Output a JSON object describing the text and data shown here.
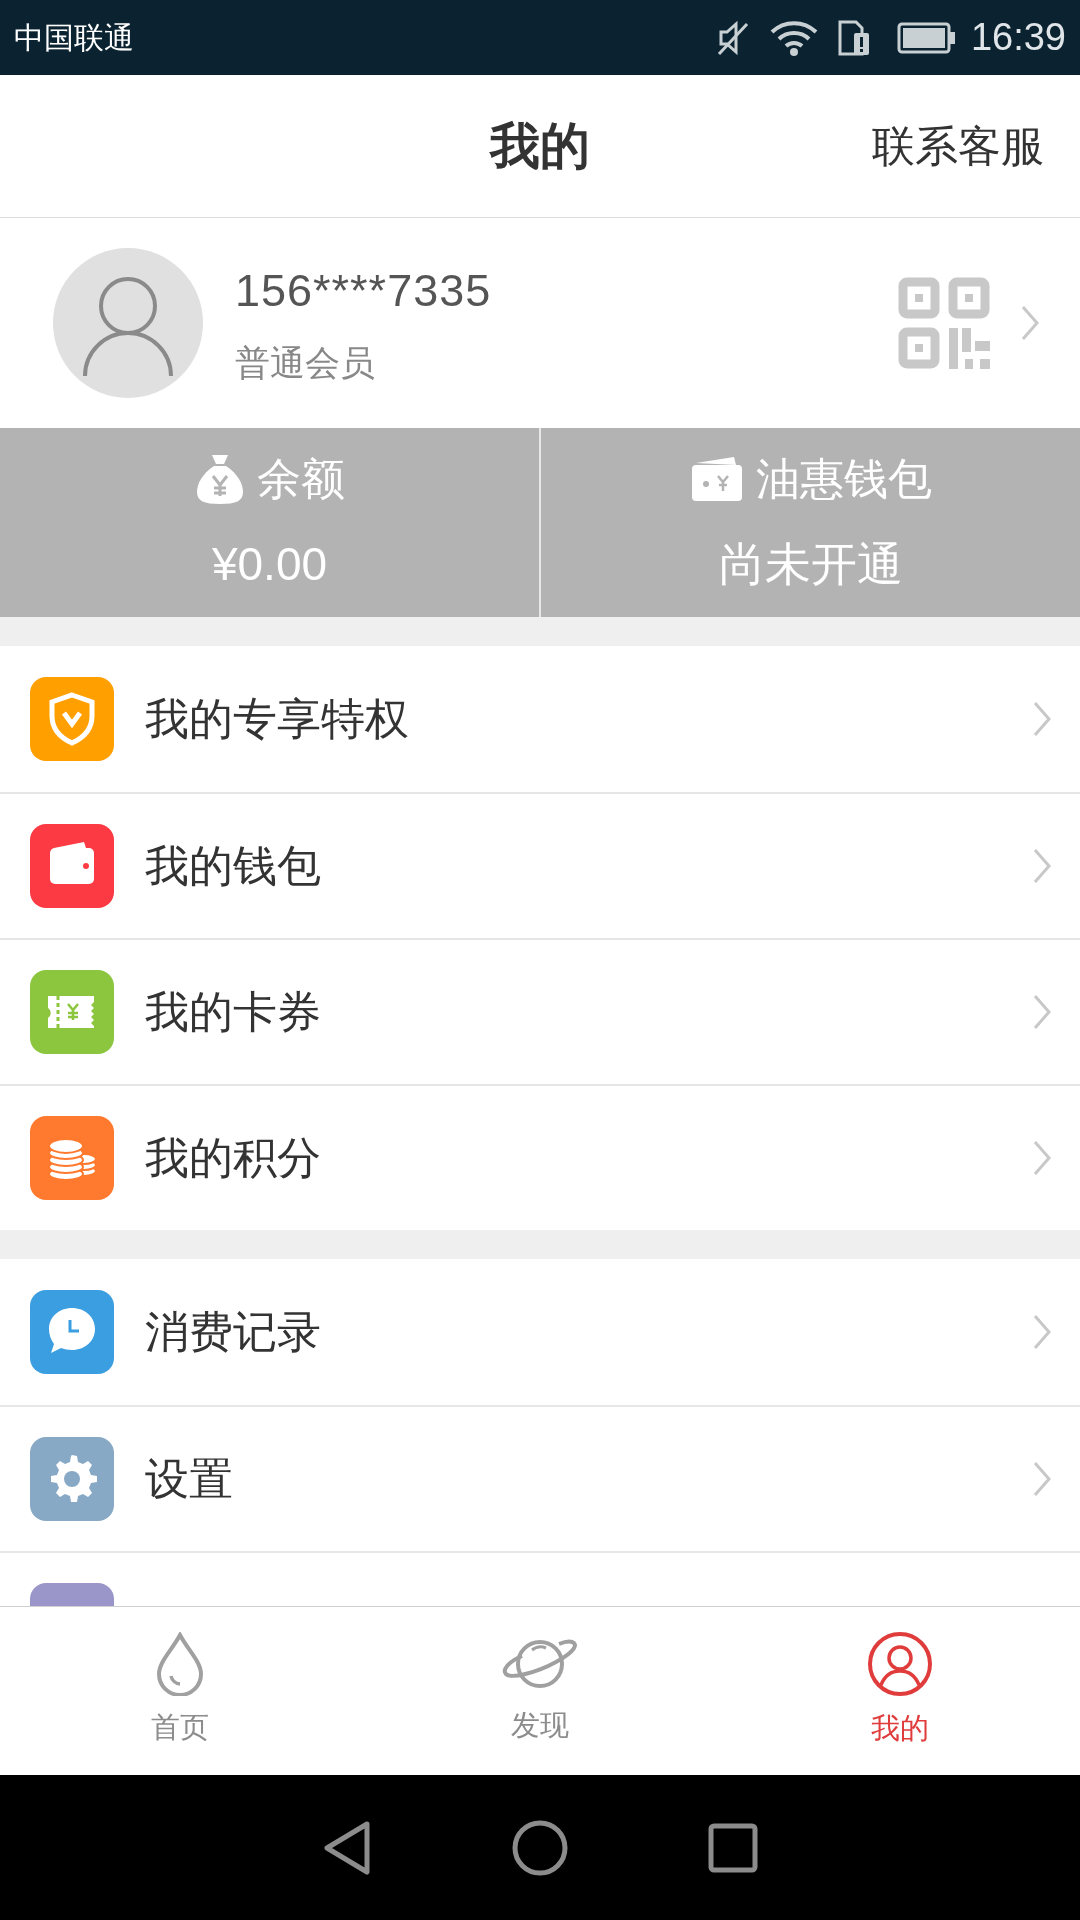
{
  "status_bar": {
    "carrier": "中国联通",
    "time": "16:39"
  },
  "header": {
    "title": "我的",
    "action": "联系客服"
  },
  "profile": {
    "phone": "156****7335",
    "level": "普通会员"
  },
  "balances": [
    {
      "label": "余额",
      "value": "¥0.00"
    },
    {
      "label": "油惠钱包",
      "value": "尚未开通"
    }
  ],
  "menu_groups": [
    [
      {
        "label": "我的专享特权",
        "color": "#ff9f00"
      },
      {
        "label": "我的钱包",
        "color": "#fc3a44"
      },
      {
        "label": "我的卡券",
        "color": "#8cc63e"
      },
      {
        "label": "我的积分",
        "color": "#ff7a2e"
      }
    ],
    [
      {
        "label": "消费记录",
        "color": "#3b9ee0"
      },
      {
        "label": "设置",
        "color": "#87a9c6"
      },
      {
        "color": "#9b96c9"
      }
    ]
  ],
  "tabs": [
    {
      "label": "首页",
      "selected": false
    },
    {
      "label": "发现",
      "selected": false
    },
    {
      "label": "我的",
      "selected": true
    }
  ]
}
